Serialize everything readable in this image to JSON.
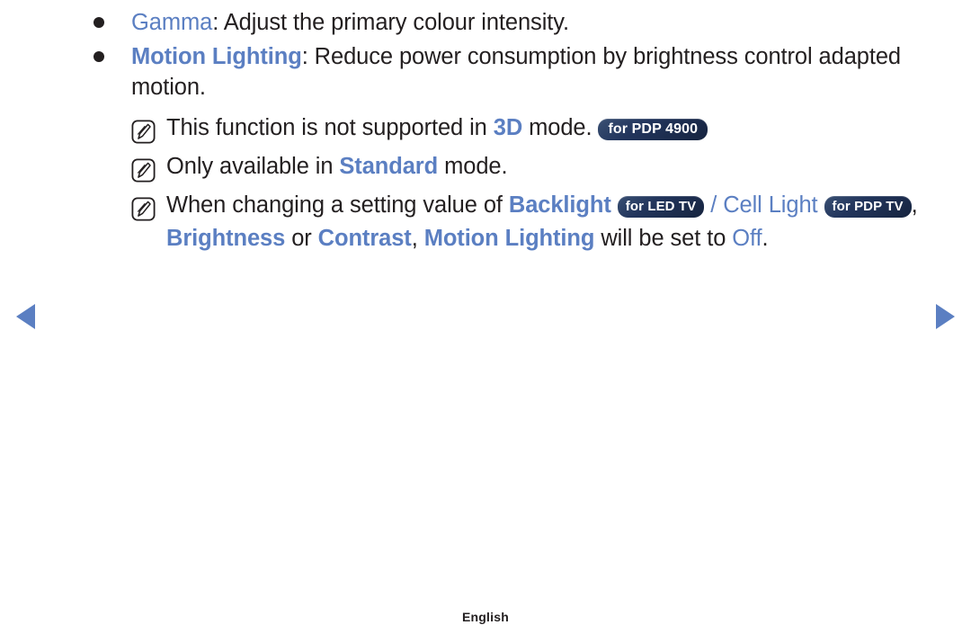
{
  "page": {
    "language_footer": "English",
    "accent_blue": "#5b7fc2",
    "text_black": "#231f20",
    "badge_navy": "#22355c"
  },
  "nav": {
    "prev_icon": "triangle-left-icon",
    "next_icon": "triangle-right-icon",
    "prev_label": "Previous page",
    "next_label": "Next page"
  },
  "bullets": [
    {
      "icon": "bullet-dot-icon",
      "term": "Gamma",
      "separator": ": ",
      "description": "Adjust the primary colour intensity."
    },
    {
      "icon": "bullet-dot-icon",
      "term": "Motion Lighting",
      "separator": ": ",
      "description": "Reduce power consumption by brightness control adapted motion."
    }
  ],
  "notes": [
    {
      "icon": "note-pencil-icon",
      "segments": [
        {
          "type": "plain",
          "text": "This function is not supported in "
        },
        {
          "type": "keyword",
          "text": "3D"
        },
        {
          "type": "plain",
          "text": " mode. "
        },
        {
          "type": "badge",
          "text": "for PDP 4900"
        }
      ]
    },
    {
      "icon": "note-pencil-icon",
      "segments": [
        {
          "type": "plain",
          "text": "Only available in "
        },
        {
          "type": "keyword",
          "text": "Standard"
        },
        {
          "type": "plain",
          "text": " mode."
        }
      ]
    },
    {
      "icon": "note-pencil-icon",
      "segments": [
        {
          "type": "plain",
          "text": "When changing a setting value of "
        },
        {
          "type": "keyword",
          "text": "Backlight"
        },
        {
          "type": "plain",
          "text": " "
        },
        {
          "type": "badge",
          "text": "for LED TV"
        },
        {
          "type": "keyword-light",
          "text": " / Cell Light "
        },
        {
          "type": "badge",
          "text": "for PDP TV"
        },
        {
          "type": "plain",
          "text": ", "
        },
        {
          "type": "keyword",
          "text": "Brightness"
        },
        {
          "type": "plain",
          "text": " or "
        },
        {
          "type": "keyword",
          "text": "Contrast"
        },
        {
          "type": "plain",
          "text": ", "
        },
        {
          "type": "keyword",
          "text": "Motion Lighting"
        },
        {
          "type": "plain",
          "text": " will be set to "
        },
        {
          "type": "keyword-light",
          "text": "Off"
        },
        {
          "type": "plain",
          "text": "."
        }
      ]
    }
  ]
}
